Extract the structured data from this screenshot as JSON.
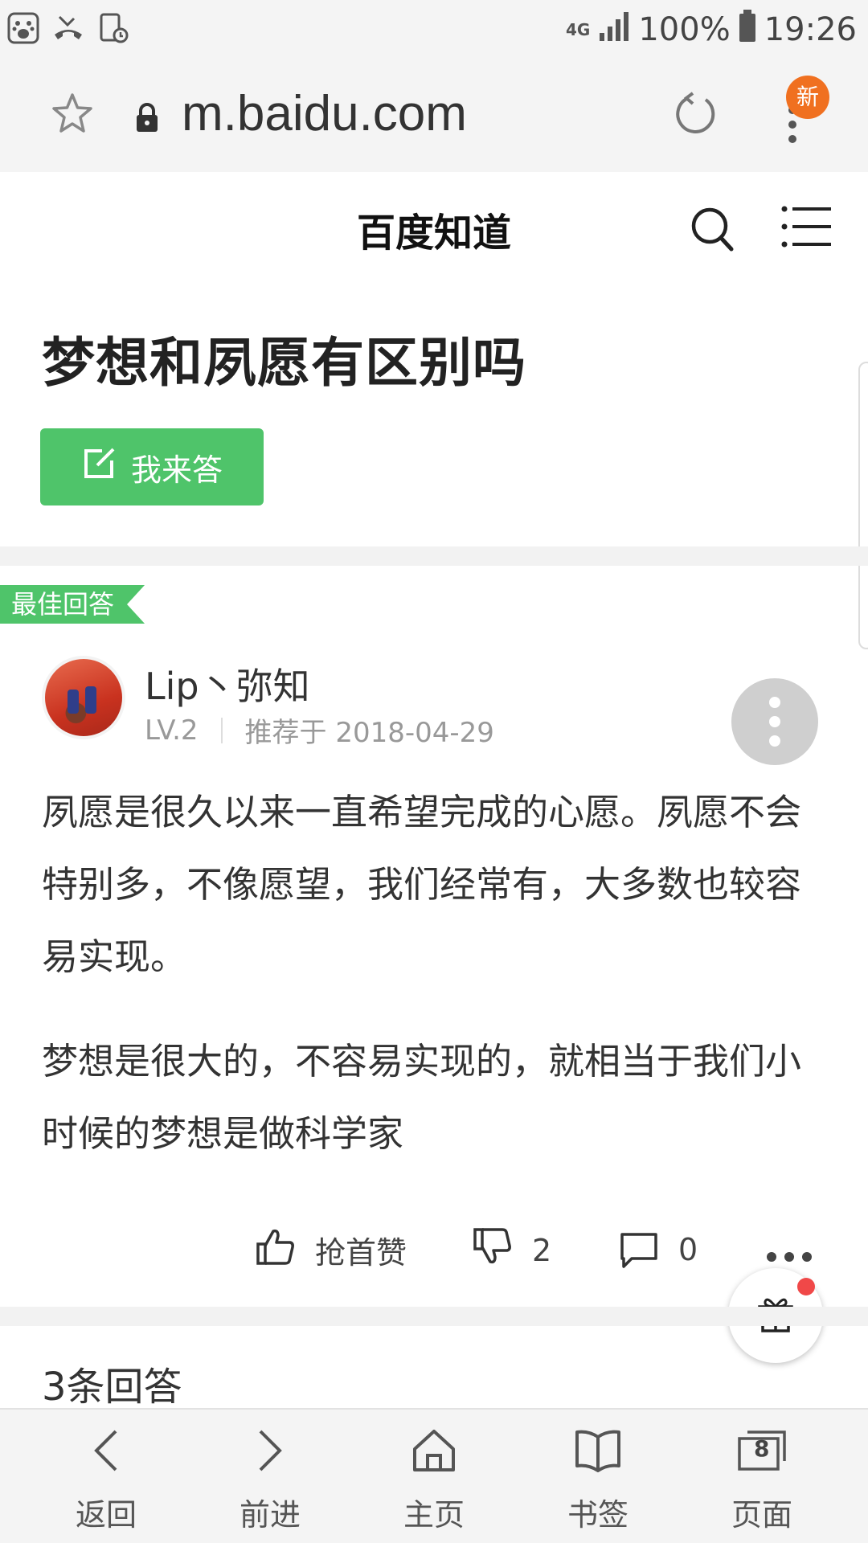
{
  "status_bar": {
    "network": "4G",
    "battery": "100%",
    "time": "19:26",
    "icons": [
      "baidu-app-icon",
      "missed-call-icon",
      "screen-recorder-icon",
      "signal-icon",
      "battery-icon"
    ]
  },
  "browser": {
    "url": "m.baidu.com",
    "new_badge": "新",
    "icons": [
      "star-icon",
      "lock-icon",
      "reload-icon",
      "more-vert-icon"
    ]
  },
  "site": {
    "title": "百度知道",
    "icons": [
      "search-icon",
      "hamburger-menu-icon"
    ]
  },
  "question": {
    "title": "梦想和夙愿有区别吗",
    "answer_button": "我来答"
  },
  "best_answer": {
    "tag": "最佳回答",
    "author": "Lip丶弥知",
    "level": "LV.2",
    "recommended": "推荐于 2018-04-29",
    "paragraphs": [
      "夙愿是很久以来一直希望完成的心愿。夙愿不会特别多，不像愿望，我们经常有，大多数也较容易实现。",
      "梦想是很大的，不容易实现的，就相当于我们小时候的梦想是做科学家"
    ],
    "actions": {
      "like_label": "抢首赞",
      "dislike_count": "2",
      "comment_count": "0"
    }
  },
  "answers_count": "3条回答",
  "bottom_nav": {
    "back": "返回",
    "forward": "前进",
    "home": "主页",
    "bookmarks": "书签",
    "pages": "页面",
    "pages_count": "8"
  },
  "colors": {
    "green": "#4fc46a",
    "orange_badge": "#f07020",
    "bar_bg": "#f4f4f4"
  }
}
